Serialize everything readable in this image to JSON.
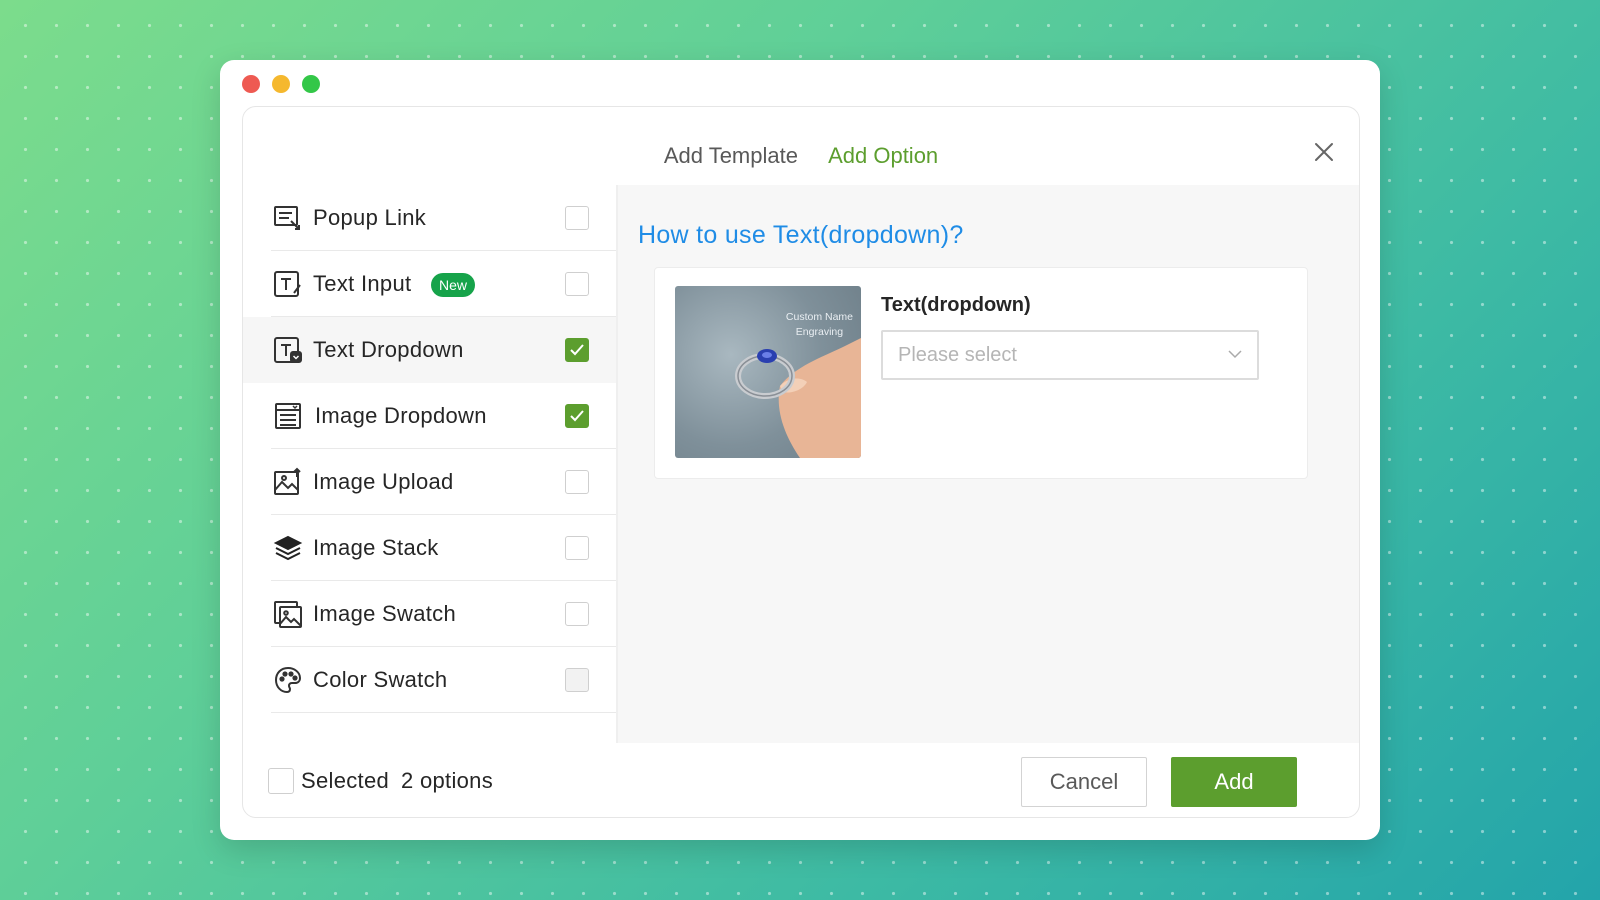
{
  "window": {
    "tabs": [
      {
        "label": "Add Template",
        "active": false
      },
      {
        "label": "Add Option",
        "active": true
      }
    ],
    "close_icon": "close-icon"
  },
  "sidebar": {
    "items": [
      {
        "label": "Popup Link",
        "icon": "popup-link-icon",
        "checked": false
      },
      {
        "label": "Text Input",
        "icon": "text-input-icon",
        "checked": false,
        "badge": "New"
      },
      {
        "label": "Text Dropdown",
        "icon": "text-dropdown-icon",
        "checked": true
      },
      {
        "label": "Image Dropdown",
        "icon": "image-dropdown-icon",
        "checked": true
      },
      {
        "label": "Image Upload",
        "icon": "image-upload-icon",
        "checked": false
      },
      {
        "label": "Image Stack",
        "icon": "image-stack-icon",
        "checked": false
      },
      {
        "label": "Image Swatch",
        "icon": "image-swatch-icon",
        "checked": false
      },
      {
        "label": "Color Swatch",
        "icon": "color-swatch-icon",
        "checked": false,
        "disabled": true
      }
    ]
  },
  "preview": {
    "title": "How to use Text(dropdown)?",
    "image_text_line1": "Custom Name",
    "image_text_line2": "Engraving",
    "field_label": "Text(dropdown)",
    "select_placeholder": "Please select"
  },
  "footer": {
    "selected_label": "Selected",
    "selected_count": "2 options",
    "cancel_label": "Cancel",
    "add_label": "Add"
  },
  "colors": {
    "accent": "#5c9e2e",
    "link": "#1f8ce6",
    "badge": "#16a34a"
  }
}
